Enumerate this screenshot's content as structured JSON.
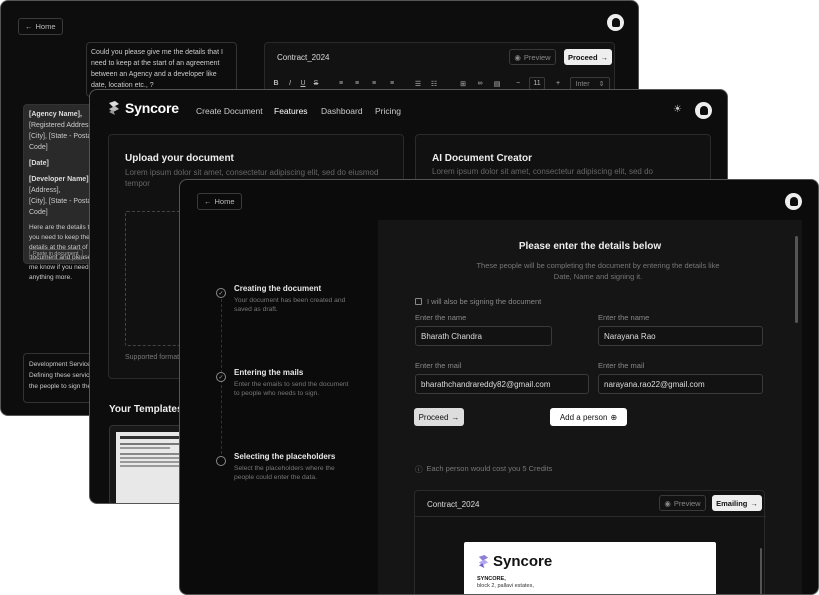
{
  "w1": {
    "home": "Home",
    "chat_question": "Could you please give me the details that I need to keep at the start of an agreement between an Agency and a developer like date, location etc., ?",
    "response_lines": [
      "[Agency Name],",
      "[Registered Address]",
      "[City], [State - Postal Code]",
      "[Date]",
      "[Developer Name]",
      "[Address],",
      "[City], [State - Postal Code]"
    ],
    "response_body": "Here are the details that you need to keep these details at the start of document and please let me know if you need anything more.",
    "paste_btn": "Paste in document",
    "bottom_line1": "Development Services",
    "bottom_line2": "Defining these services",
    "bottom_line3": "the people to sign the",
    "doc_title": "Contract_2024",
    "preview": "Preview",
    "proceed": "Proceed",
    "toolbar": {
      "bold": "B",
      "italic": "I",
      "underline": "U",
      "strike": "S",
      "font_size": "11",
      "font": "Inter",
      "minus": "−",
      "plus": "+"
    }
  },
  "w2": {
    "brand": "Syncore",
    "nav": [
      "Create Document",
      "Features",
      "Dashboard",
      "Pricing"
    ],
    "upload_title": "Upload your document",
    "upload_desc": "Lorem ipsum dolor sit amet, consectetur adipiscing elit, sed do eiusmod tempor",
    "ai_title": "AI Document Creator",
    "ai_desc": "Lorem ipsum dolor sit amet, consectetur adipiscing elit, sed do",
    "supported": "Supported formats",
    "templates": "Your Templates"
  },
  "w3": {
    "home": "Home",
    "steps": [
      {
        "title": "Creating the document",
        "desc": "Your document has been created and saved as draft."
      },
      {
        "title": "Entering the mails",
        "desc": "Enter the emails to send  the document to people who needs to sign."
      },
      {
        "title": "Selecting the placeholders",
        "desc": "Select the placeholders where the people could enter the data."
      }
    ],
    "form_title": "Please enter the details below",
    "form_sub": "These people will be completing the document by entering the details like Date, Name and signing it.",
    "also_signing": "I will also be signing the document",
    "name_label": "Enter the name",
    "mail_label": "Enter the mail",
    "person1": {
      "name": "Bharath Chandra",
      "mail": "bharathchandrareddy82@gmail.com"
    },
    "person2": {
      "name": "Narayana Rao",
      "mail": "narayana.rao22@gmail.com"
    },
    "proceed": "Proceed",
    "add_person": "Add a person",
    "credits": "Each person would cost you 5 Credits",
    "doc_title": "Contract_2024",
    "preview": "Preview",
    "emailing": "Emailing",
    "doc_brand": "Syncore",
    "doc_company": "SYNCORE,",
    "doc_address": "block 2, pallavi estates,"
  }
}
